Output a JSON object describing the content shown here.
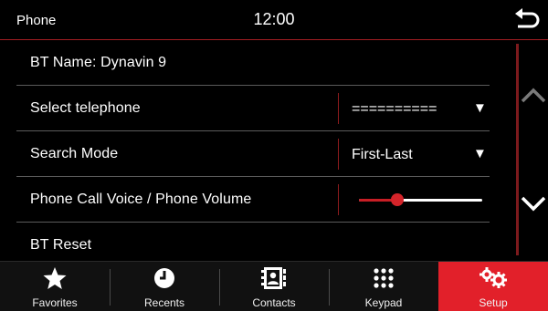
{
  "header": {
    "title": "Phone",
    "time": "12:00",
    "back_icon": "back-arrow-icon"
  },
  "settings": {
    "bt_name": "BT Name: Dynavin 9",
    "select_telephone": {
      "label": "Select telephone",
      "value": "=========="
    },
    "search_mode": {
      "label": "Search Mode",
      "value": "First-Last"
    },
    "phone_volume": {
      "label": "Phone Call Voice / Phone Volume",
      "level": 0.31
    },
    "bt_reset": "BT Reset"
  },
  "scroll": {
    "up_icon": "chevron-up-icon",
    "down_icon": "chevron-down-icon"
  },
  "nav": {
    "items": [
      {
        "label": "Favorites",
        "icon": "star-icon"
      },
      {
        "label": "Recents",
        "icon": "clock-icon"
      },
      {
        "label": "Contacts",
        "icon": "address-book-icon"
      },
      {
        "label": "Keypad",
        "icon": "keypad-icon"
      },
      {
        "label": "Setup",
        "icon": "gears-icon"
      }
    ],
    "active": "Setup"
  },
  "colors": {
    "accent": "#e2202a",
    "background": "#000000",
    "divider": "#5b5b5b"
  }
}
